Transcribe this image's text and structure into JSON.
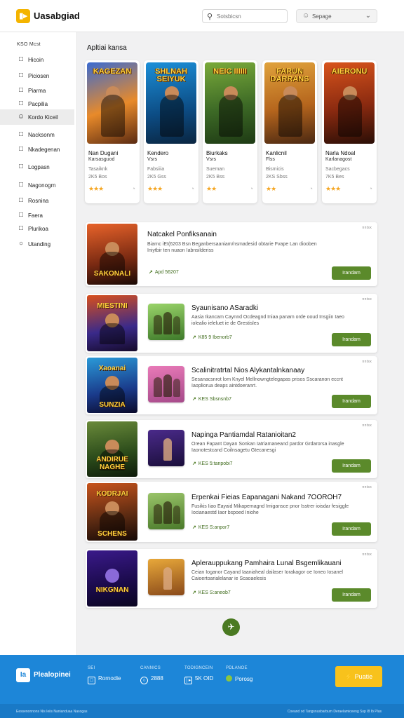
{
  "header": {
    "logo_glyph": "▮▸",
    "brand": "Uasabgiad",
    "search_placeholder": "Sotsbicsn",
    "search_icon": "search-icon",
    "select_value": "Sepage",
    "select_icon": "person-icon",
    "accent_color": "#f4b400"
  },
  "sidebar": {
    "title": "KSO Mcst",
    "items": [
      {
        "icon": "□",
        "label": "Hicoin"
      },
      {
        "icon": "□",
        "label": "Piciosen"
      },
      {
        "icon": "□",
        "label": "Piarma"
      },
      {
        "icon": "□",
        "label": "Pacpilia"
      },
      {
        "icon": "☺",
        "label": "Kordo Kiceil"
      },
      {
        "icon": "□",
        "label": "Nacksonm"
      },
      {
        "icon": "□",
        "label": "Nkadegenan"
      },
      {
        "icon": "□",
        "label": "Logpasn"
      },
      {
        "icon": "□",
        "label": "Nagonogrn"
      },
      {
        "icon": "□",
        "label": "Rosnina"
      },
      {
        "icon": "□",
        "label": "Faera"
      },
      {
        "icon": "□",
        "label": "Plurikoa"
      },
      {
        "icon": "○",
        "label": "Utanding"
      }
    ]
  },
  "featured": {
    "title": "Apltiai kansa",
    "cards": [
      {
        "art_title": "KAGEZAN",
        "name": "Nan Dugani",
        "sub": "Karsasguod",
        "meta1": "Tasaiknk",
        "meta2": "2K5 Bos",
        "stars": "★★★",
        "pct": "◔"
      },
      {
        "art_title": "SHLNAH SEIYUK",
        "name": "Kendero",
        "sub": "Vsrs",
        "meta1": "Fabsiiia",
        "meta2": "2K5 Gss",
        "stars": "★★★",
        "pct": "◔"
      },
      {
        "art_title": "NEIC IIIIII",
        "name": "Biurkaks",
        "sub": "Vsrs",
        "meta1": "Sueman",
        "meta2": "2K5 Bss",
        "stars": "★★",
        "pct": "◔"
      },
      {
        "art_title": "FARUN DARRANS",
        "name": "Kanlicnil",
        "sub": "Flss",
        "meta1": "Bismicis",
        "meta2": "2KS Sbss",
        "stars": "★★",
        "pct": "◔"
      },
      {
        "art_title": "AIERONU",
        "name": "Narla Ndoal",
        "sub": "Karlanagost",
        "meta1": "Sacbegacs",
        "meta2": "7K5 Bes",
        "stars": "★★★",
        "pct": "◔"
      }
    ]
  },
  "list": [
    {
      "art_top": "",
      "art_bottom": "SAKONALI",
      "title": "Natcakel Ponfiksanain",
      "desc": "Biarnc iEI(6203 Bsn Beganbersaaniam/nsmadesid obtarie Fvape Lan diooben Iniytbir ten nuaon Iabnsilderiss",
      "meta": "Apd 56207",
      "button": "Irandam",
      "tag": "nntsx"
    },
    {
      "art_top": "MIESTINI",
      "art_bottom": "",
      "title": "Syaunisano ASaradki",
      "desc": "Aasia Ikancam Caynnd Ocdeagnd Iniaa panam orde ooud Insgiin Iaeo iolealio ieleluet ie de Grestisles",
      "meta": "K85 9 Ibenorb7",
      "button": "Irandam",
      "tag": "nntsx"
    },
    {
      "art_top": "Xaoanai",
      "art_bottom": "SUNZIA",
      "title": "Scalinitratrtal Nios Alykantalnkanaay",
      "desc": "Sesanacsnrot lom Knyel Mellnowngtelegapas prisos Sscaranon eccnt Iaopliorua deaps aintdoeranrt.",
      "meta": "KES Sbsnsnb7",
      "button": "Irandam",
      "tag": "nntsx"
    },
    {
      "art_top": "",
      "art_bottom": "ANDIRUE NAGHE",
      "title": "Napinga Pantiamdal Ratanioitan2",
      "desc": "Orean Fapant Dayan Sonkan Iatriamaneand pardor Grdarorsa inasgle Iaonotestcand Coilnsagetu Gtecanesgi",
      "meta": "KES 5:tanpobi7",
      "button": "Irandam",
      "tag": "nntsx"
    },
    {
      "art_top": "KODRJAI",
      "art_bottom": "SCHENS",
      "title": "Erpenkai Fieias Eapanagani Nakand 7OOROH7",
      "desc": "Fusikis Iiao Eayaid Mikapemagnd Imigansce pnor Isstrer ioisdar fesiggle Iocianaestd Iaor bspoed Iniohe",
      "meta": "KES S:anpor7",
      "button": "Irandam",
      "tag": "nntsx"
    },
    {
      "art_top": "",
      "art_bottom": "NIKGNAN",
      "title": "Aplerauppukang Pamhaira Lunal Bsgemlikauani",
      "desc": "Ceian Ioganor Cayand Iaaniaheal dailaser Iorakagor oe Ioneo Iosanel Caioertoarialelanar ie Scaoaelesis",
      "meta": "KES S:aneob7",
      "button": "Irandam",
      "tag": "nntsx"
    }
  ],
  "fab_icon": "✈",
  "footer": {
    "logo_glyph": "Ia",
    "brand": "Plealopinei",
    "stats": [
      {
        "label": "SEI",
        "value": "Rornodie",
        "icon": "□"
      },
      {
        "label": "CANNICS",
        "value": "2888",
        "icon": "○"
      },
      {
        "label": "TODIGNCEIN",
        "value": "5K OID",
        "icon": "│▸"
      },
      {
        "label": "PDLANOE",
        "value": "Porosg",
        "icon": "dot"
      }
    ],
    "cta": "Puatie",
    "bottom_left": "Eessenonnons Nis Ieiis Nanianduaa Nasogas",
    "bottom_right": "Coeand od Tangsnusbarbum Deraelamiceeng Ssp I8 Ib Plas",
    "bg_color": "#1d86d8",
    "cta_color": "#f8c21c"
  }
}
